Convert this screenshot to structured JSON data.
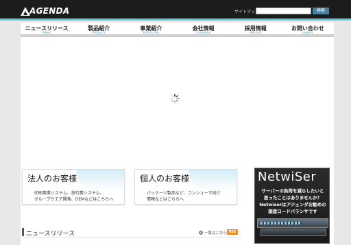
{
  "header": {
    "logo_text": "AGENDA",
    "sitemap_label": "サイトマップ",
    "search": {
      "placeholder": "",
      "button_label": "検索"
    }
  },
  "nav": [
    {
      "ja": "ニュースリリース",
      "en": "News"
    },
    {
      "ja": "製品紹介",
      "en": "Products"
    },
    {
      "ja": "事業紹介",
      "en": "Enterprise"
    },
    {
      "ja": "会社情報",
      "en": "Company"
    },
    {
      "ja": "採用情報",
      "en": "Recruit"
    },
    {
      "ja": "お問い合わせ",
      "en": "Inquiry"
    }
  ],
  "cards": {
    "corporate": {
      "title": "法人のお客様",
      "desc_line1": "印刷事業システム、旅行業システム、",
      "desc_line2": "グループウエア開発、OEMなどはこちらへ"
    },
    "personal": {
      "title": "個人のお客様",
      "desc_line1": "パッケージ製品など、コンシューマ向け",
      "desc_line2": "情報などはこちらへ"
    }
  },
  "banner": {
    "brand": "NetwiSer",
    "line1": "サーバーの負荷を減らしたいと",
    "line2": "思ったことはありませんか？",
    "line3": "Netwiserはアジェンダお勧めの",
    "line4": "国産ロードバランサです"
  },
  "news": {
    "title": "ニュースリリース",
    "list_link": "一覧はこちら",
    "rss_label": "RSS"
  },
  "colors": {
    "header_bg": "#1c1c1c",
    "accent": "#5fc8e0",
    "rss": "#f08a24"
  }
}
